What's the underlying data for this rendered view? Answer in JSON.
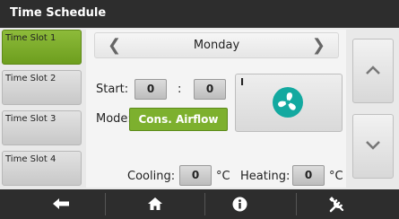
{
  "header": {
    "title": "Time Schedule"
  },
  "slots": [
    {
      "label": "Time Slot 1",
      "active": true
    },
    {
      "label": "Time Slot 2",
      "active": false
    },
    {
      "label": "Time Slot 3",
      "active": false
    },
    {
      "label": "Time Slot 4",
      "active": false
    }
  ],
  "schedule": {
    "day": "Monday",
    "start_label": "Start:",
    "start_hour": "0",
    "time_separator": ":",
    "start_minute": "0",
    "mode_label": "Mode:",
    "mode_value": "Cons. Airflow",
    "fan_state": "I",
    "cooling_label": "Cooling:",
    "cooling_value": "0",
    "cooling_unit": "°C",
    "heating_label": "Heating:",
    "heating_value": "0",
    "heating_unit": "°C"
  },
  "colors": {
    "active": "#7db02e",
    "fan": "#13a9a0",
    "bar": "#2d2d2d"
  },
  "icons": {
    "prev_day": "chevron-left-icon",
    "next_day": "chevron-right-icon",
    "scroll_up": "chevron-up-icon",
    "scroll_down": "chevron-down-icon",
    "fan": "fan-icon",
    "nav": [
      "back-arrow-icon",
      "home-icon",
      "info-icon",
      "tools-icon"
    ]
  }
}
